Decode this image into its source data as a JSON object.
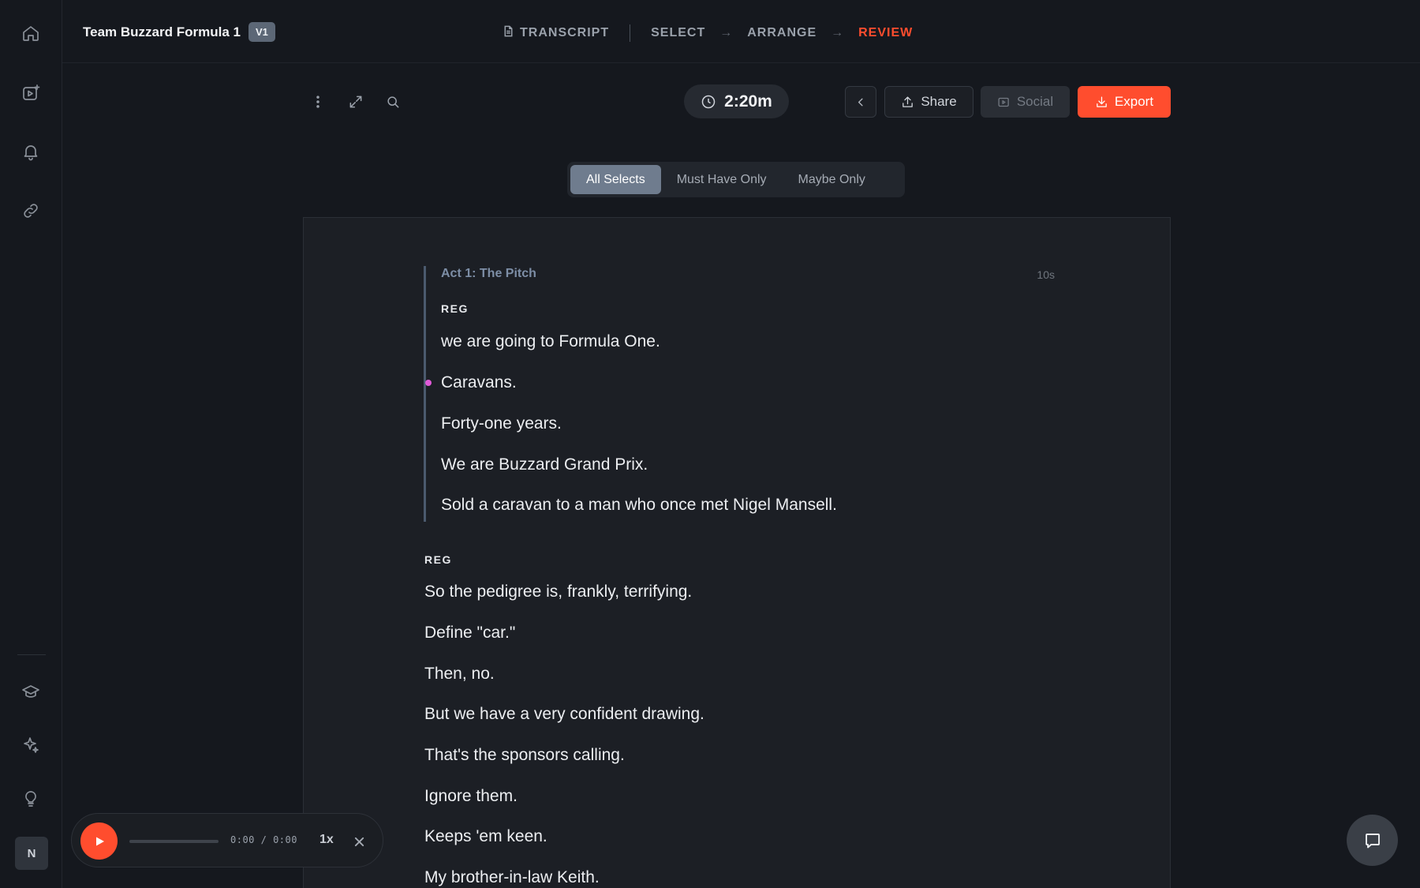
{
  "project": {
    "title": "Team Buzzard Formula 1",
    "version": "V1"
  },
  "steps": [
    {
      "label": "TRANSCRIPT"
    },
    {
      "label": "SELECT"
    },
    {
      "label": "ARRANGE"
    },
    {
      "label": "REVIEW",
      "active": true
    }
  ],
  "toolbar": {
    "duration": "2:20m",
    "share_label": "Share",
    "social_label": "Social",
    "export_label": "Export"
  },
  "filter": {
    "options": [
      "All Selects",
      "Must Have Only",
      "Maybe Only"
    ],
    "selected": "All Selects"
  },
  "transcript": {
    "act": {
      "title": "Act 1: The Pitch",
      "duration": "10s",
      "speaker": "REG",
      "lines": [
        "we are going to Formula One.",
        "Caravans.",
        "Forty-one years.",
        "We are Buzzard Grand Prix.",
        "Sold a caravan to a man who once met Nigel Mansell."
      ]
    },
    "block": {
      "speaker": "REG",
      "lines": [
        "So the pedigree is, frankly, terrifying.",
        "Define \"car.\"",
        "Then, no.",
        "But we have a very confident drawing.",
        "That's the sponsors calling.",
        "Ignore them.",
        "Keeps 'em keen.",
        "My brother-in-law Keith."
      ]
    }
  },
  "player": {
    "time": "0:00 / 0:00",
    "speed": "1x",
    "progress": 0
  },
  "user": {
    "initial": "N"
  },
  "colors": {
    "accent": "#ff4d2e",
    "marker": "#e05ad8",
    "act_border": "#4b5a6e"
  },
  "icons": {
    "rail": [
      "home-icon",
      "video-add-icon",
      "bell-icon",
      "link-icon",
      "graduation-cap-icon",
      "sparkle-icon",
      "lightbulb-icon"
    ],
    "toolbar": [
      "more-vertical-icon",
      "expand-icon",
      "search-icon",
      "clock-icon",
      "chevron-left-icon",
      "upload-icon",
      "social-icon",
      "download-icon"
    ]
  }
}
